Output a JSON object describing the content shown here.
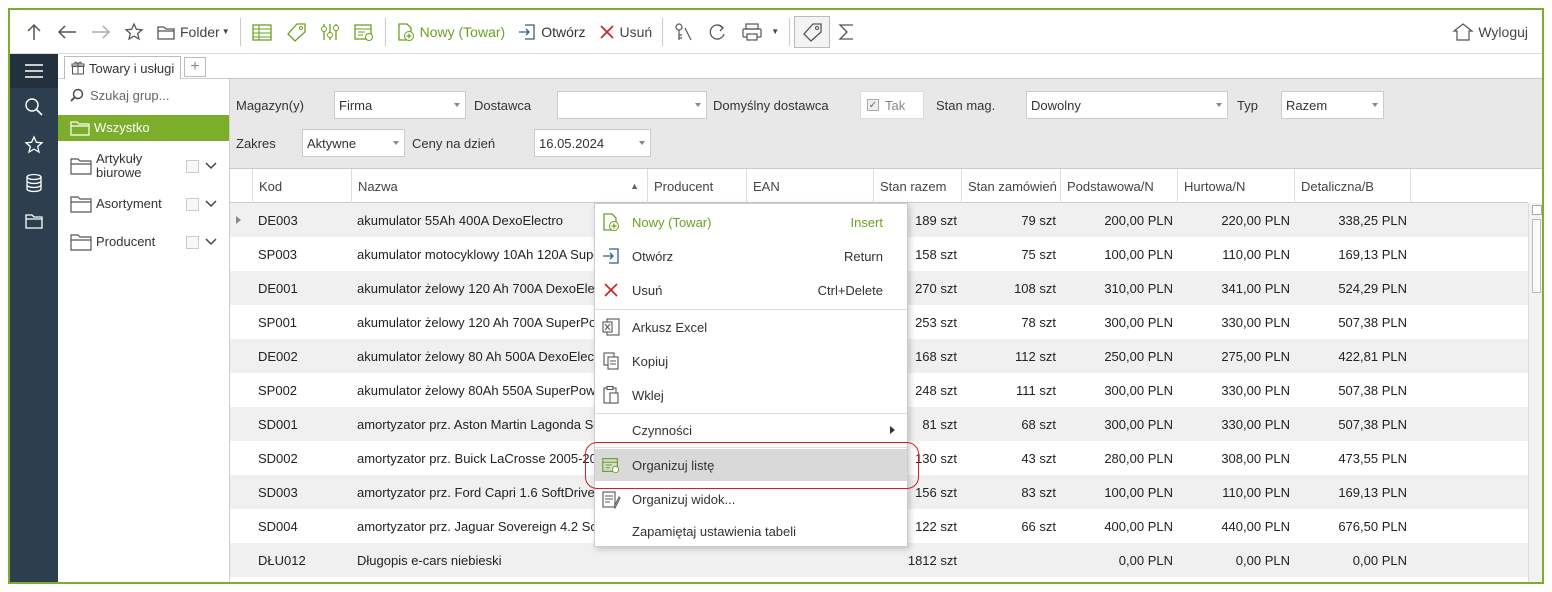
{
  "toolbar": {
    "folder_label": "Folder",
    "new_label": "Nowy (Towar)",
    "open_label": "Otwórz",
    "delete_label": "Usuń",
    "logout_label": "Wyloguj"
  },
  "tabs": {
    "active_label": "Towary i usługi"
  },
  "groups": {
    "search_placeholder": "Szukaj grup...",
    "items": [
      {
        "label": "Wszystko"
      },
      {
        "label_line1": "Artykuły",
        "label_line2": "biurowe"
      },
      {
        "label": "Asortyment"
      },
      {
        "label": "Producent"
      }
    ]
  },
  "filters": {
    "magazyn_label": "Magazyn(y)",
    "magazyn_value": "Firma",
    "dostawca_label": "Dostawca",
    "dostawca_value": "",
    "domyslny_label": "Domyślny dostawca",
    "domyslny_value": "Tak",
    "stan_label": "Stan mag.",
    "stan_value": "Dowolny",
    "typ_label": "Typ",
    "typ_value": "Razem",
    "zakres_label": "Zakres",
    "zakres_value": "Aktywne",
    "ceny_label": "Ceny na dzień",
    "ceny_value": "16.05.2024"
  },
  "grid": {
    "columns": [
      "Kod",
      "Nazwa",
      "Producent",
      "EAN",
      "Stan razem",
      "Stan zamówień",
      "Podstawowa/N",
      "Hurtowa/N",
      "Detaliczna/B"
    ],
    "rows": [
      {
        "kod": "DE003",
        "nazwa": "akumulator 55Ah 400A DexoElectro",
        "stan": "189 szt",
        "zam": "79 szt",
        "podst": "200,00 PLN",
        "hurt": "220,00 PLN",
        "det": "338,25 PLN"
      },
      {
        "kod": "SP003",
        "nazwa": "akumulator motocyklowy 10Ah 120A SuperPower",
        "stan": "158 szt",
        "zam": "75 szt",
        "podst": "100,00 PLN",
        "hurt": "110,00 PLN",
        "det": "169,13 PLN"
      },
      {
        "kod": "DE001",
        "nazwa": "akumulator żelowy 120 Ah 700A DexoElectro",
        "stan": "270 szt",
        "zam": "108 szt",
        "podst": "310,00 PLN",
        "hurt": "341,00 PLN",
        "det": "524,29 PLN"
      },
      {
        "kod": "SP001",
        "nazwa": "akumulator żelowy 120 Ah 700A SuperPower",
        "stan": "253 szt",
        "zam": "78 szt",
        "podst": "300,00 PLN",
        "hurt": "330,00 PLN",
        "det": "507,38 PLN"
      },
      {
        "kod": "DE002",
        "nazwa": "akumulator żelowy 80 Ah 500A DexoElectro",
        "stan": "168 szt",
        "zam": "112 szt",
        "podst": "250,00 PLN",
        "hurt": "275,00 PLN",
        "det": "422,81 PLN"
      },
      {
        "kod": "SP002",
        "nazwa": "akumulator żelowy 80Ah 550A SuperPower",
        "stan": "248 szt",
        "zam": "111 szt",
        "podst": "300,00 PLN",
        "hurt": "330,00 PLN",
        "det": "507,38 PLN"
      },
      {
        "kod": "SD001",
        "nazwa": "amortyzator prz. Aston Martin Lagonda SoftDrive",
        "stan": "81 szt",
        "zam": "68 szt",
        "podst": "300,00 PLN",
        "hurt": "330,00 PLN",
        "det": "507,38 PLN"
      },
      {
        "kod": "SD002",
        "nazwa": "amortyzator prz. Buick LaCrosse 2005-2008 SoftDrive",
        "stan": "130 szt",
        "zam": "43 szt",
        "podst": "280,00 PLN",
        "hurt": "308,00 PLN",
        "det": "473,55 PLN"
      },
      {
        "kod": "SD003",
        "nazwa": "amortyzator prz. Ford Capri 1.6 SoftDrive",
        "stan": "156 szt",
        "zam": "83 szt",
        "podst": "100,00 PLN",
        "hurt": "110,00 PLN",
        "det": "169,13 PLN"
      },
      {
        "kod": "SD004",
        "nazwa": "amortyzator prz. Jaguar Sovereign 4.2 SoftDrive",
        "stan": "122 szt",
        "zam": "66 szt",
        "podst": "400,00 PLN",
        "hurt": "440,00 PLN",
        "det": "676,50 PLN"
      },
      {
        "kod": "DŁU012",
        "nazwa": "Długopis e-cars niebieski",
        "stan": "1812 szt",
        "zam": "",
        "podst": "0,00 PLN",
        "hurt": "0,00 PLN",
        "det": "0,00 PLN"
      }
    ]
  },
  "context_menu": {
    "items": [
      {
        "label": "Nowy (Towar)",
        "shortcut": "Insert"
      },
      {
        "label": "Otwórz",
        "shortcut": "Return"
      },
      {
        "label": "Usuń",
        "shortcut": "Ctrl+Delete"
      },
      {
        "label": "Arkusz Excel"
      },
      {
        "label": "Kopiuj"
      },
      {
        "label": "Wklej"
      },
      {
        "label": "Czynności"
      },
      {
        "label": "Organizuj listę"
      },
      {
        "label": "Organizuj widok..."
      },
      {
        "label": "Zapamiętaj ustawienia tabeli"
      }
    ]
  },
  "colors": {
    "accent": "#7cae2b",
    "sidebar": "#2d3f4e",
    "delete_red": "#d02020",
    "link_blue": "#2f5f8a"
  }
}
